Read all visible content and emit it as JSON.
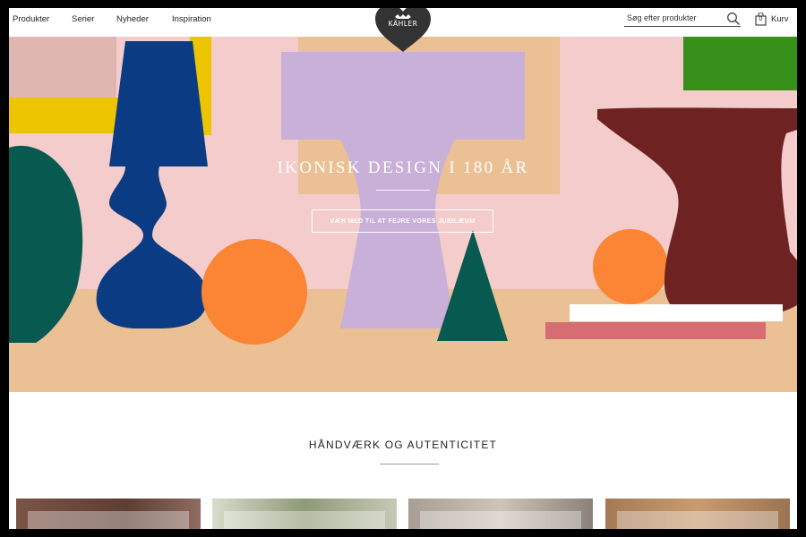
{
  "header": {
    "nav": [
      {
        "label": "Produkter"
      },
      {
        "label": "Serier"
      },
      {
        "label": "Nyheder"
      },
      {
        "label": "Inspiration"
      }
    ],
    "logo_text": "KÄHLER",
    "search": {
      "placeholder": "Søg efter produkter",
      "icon": "search-icon"
    },
    "cart": {
      "label": "Kurv",
      "count": "0",
      "icon": "bag-icon"
    }
  },
  "hero": {
    "title": "IKONISK DESIGN I 180 ÅR",
    "button_label": "VÆR MED TIL AT FEJRE VORES JUBILÆUM",
    "colors": {
      "background": "#f3cccb",
      "floor": "#ebc095",
      "lilac": "#c8b0d8",
      "navy": "#0b3b82",
      "orange": "#fb8435",
      "teal": "#08594f",
      "maroon": "#6e2222",
      "green": "#36901a",
      "yellow": "#ecc400",
      "pink": "#d76c72"
    }
  },
  "section": {
    "title": "HÅNDVÆRK OG AUTENTICITET"
  },
  "cards": [
    {
      "name": "card-1",
      "color": "#6e4a3e"
    },
    {
      "name": "card-2",
      "color": "#a8ab92"
    },
    {
      "name": "card-3",
      "color": "#b2a99e"
    },
    {
      "name": "card-4",
      "color": "#b08660"
    }
  ]
}
